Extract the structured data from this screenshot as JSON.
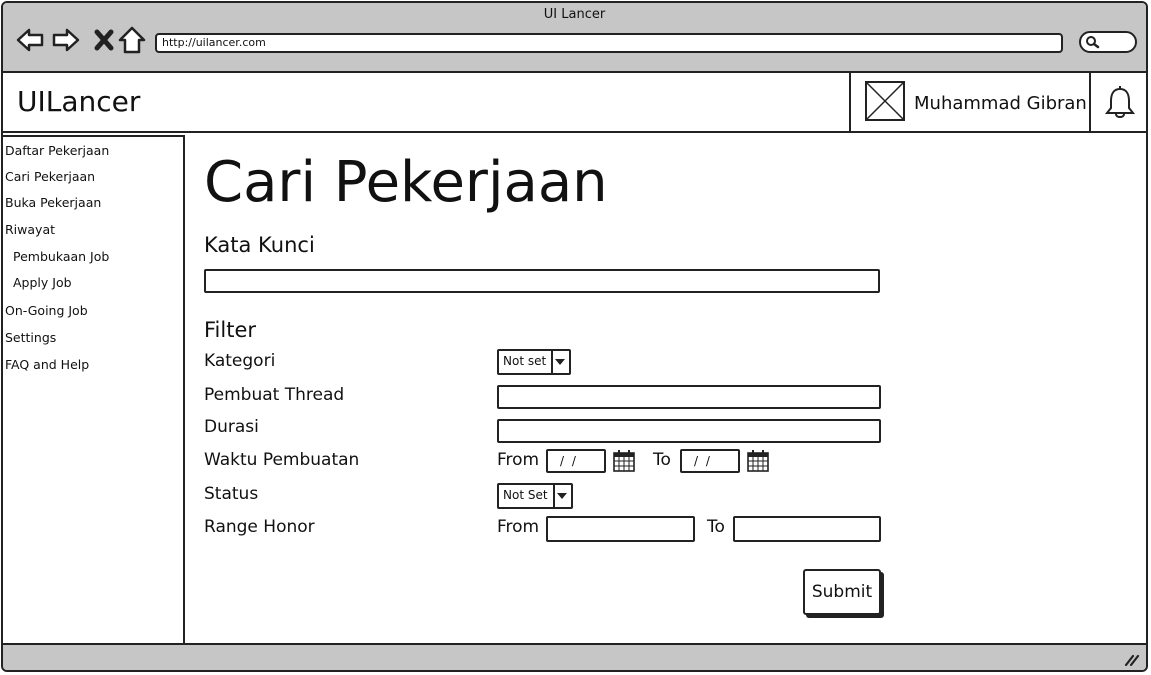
{
  "window": {
    "title": "UI Lancer",
    "url": "http://uilancer.com"
  },
  "header": {
    "brand": "UILancer",
    "user_name": "Muhammad Gibran"
  },
  "sidebar": {
    "items": [
      {
        "label": "Daftar Pekerjaan"
      },
      {
        "label": "Cari Pekerjaan"
      },
      {
        "label": "Buka Pekerjaan"
      },
      {
        "label": "Riwayat"
      },
      {
        "label": "Pembukaan Job"
      },
      {
        "label": "Apply Job"
      },
      {
        "label": "On-Going Job"
      },
      {
        "label": "Settings"
      },
      {
        "label": "FAQ and Help"
      }
    ]
  },
  "main": {
    "title": "Cari Pekerjaan",
    "keyword_label": "Kata Kunci",
    "keyword_value": "",
    "filter_label": "Filter",
    "fields": {
      "kategori": {
        "label": "Kategori",
        "value": "Not set"
      },
      "pembuat": {
        "label": "Pembuat Thread",
        "value": ""
      },
      "durasi": {
        "label": "Durasi",
        "value": ""
      },
      "waktu": {
        "label": "Waktu Pembuatan",
        "from_label": "From",
        "to_label": "To",
        "from_value": "/ /",
        "to_value": "/ /"
      },
      "status": {
        "label": "Status",
        "value": "Not Set"
      },
      "honor": {
        "label": "Range Honor",
        "from_label": "From",
        "to_label": "To",
        "from_value": "",
        "to_value": ""
      }
    },
    "submit_label": "Submit"
  }
}
